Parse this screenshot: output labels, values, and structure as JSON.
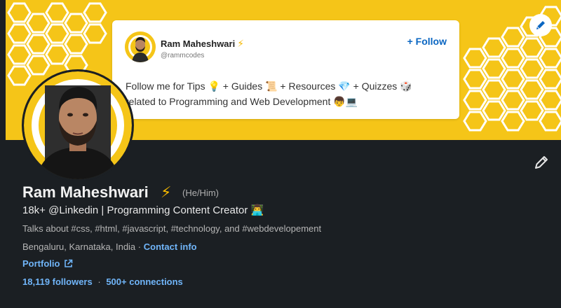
{
  "colors": {
    "banner": "#f5c518",
    "background": "#1b1f23",
    "link": "#70b5f9",
    "follow": "#0a66c2"
  },
  "banner_card": {
    "name": "Ram Maheshwari",
    "name_icon": "lightning-bolt-icon",
    "handle": "@rammcodes",
    "follow_label": "+ Follow",
    "body_line1": "Follow me for Tips 💡 + Guides 📜 + Resources 💎 + Quizzes 🎲",
    "body_line2": "related to Programming and Web Development 👦💻"
  },
  "profile": {
    "name": "Ram Maheshwari",
    "name_icon": "lightning-bolt-icon",
    "pronouns": "(He/Him)",
    "headline": "18k+ @Linkedin | Programming Content Creator 👨‍💻",
    "talks_about": "Talks about #css, #html, #javascript, #technology, and #webdevelopement",
    "location": "Bengaluru, Karnataka, India",
    "separator": "·",
    "contact_info": "Contact info",
    "portfolio": "Portfolio",
    "followers": "18,119 followers",
    "connections": "500+ connections"
  }
}
